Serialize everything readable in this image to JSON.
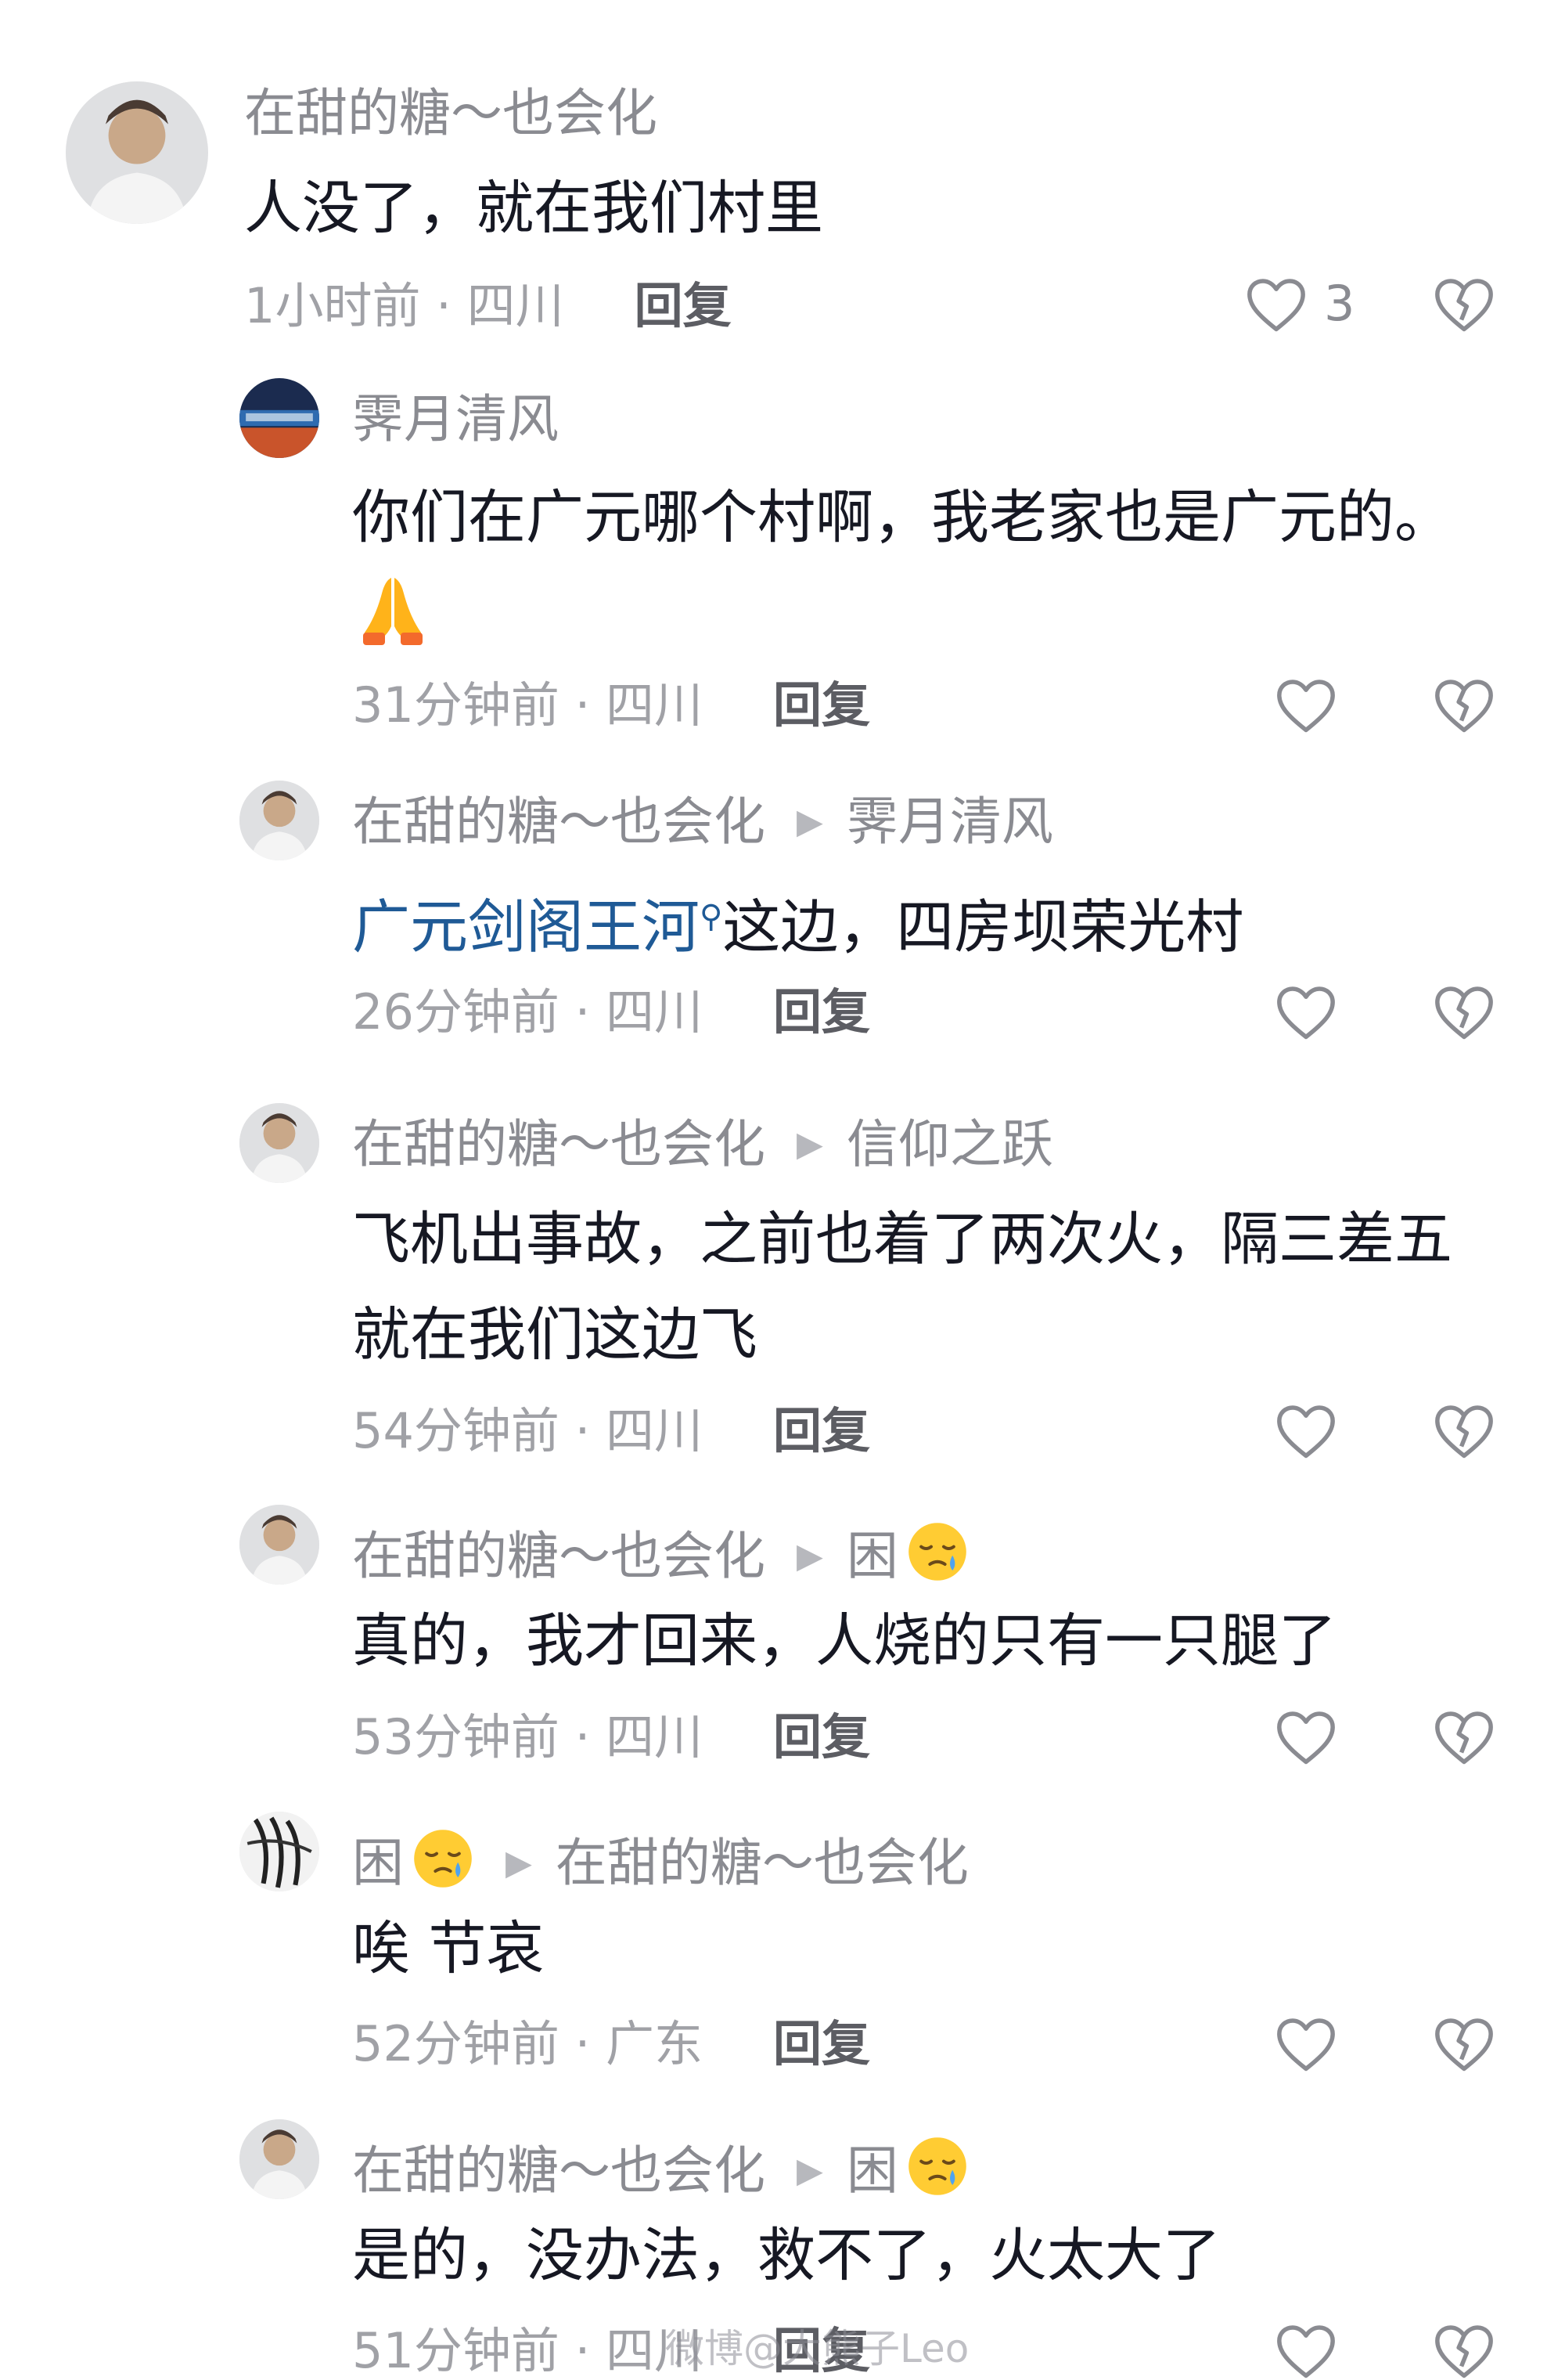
{
  "comments": [
    {
      "author": "在甜的糖～也会化",
      "reply_to": "",
      "text": "人没了，就在我们村里",
      "time_location": "1小时前 · 四川",
      "reply_label": "回复",
      "like_count": "3"
    },
    {
      "author": "霁月清风",
      "reply_to": "",
      "text": "你们在广元哪个村啊，我老家也是广元的。",
      "time_location": "31分钟前 · 四川",
      "reply_label": "回复",
      "like_count": ""
    },
    {
      "author": "在甜的糖～也会化",
      "reply_to": "霁月清风",
      "text_highlight": "广元剑阁王河",
      "text": "这边，四房坝荣光村",
      "time_location": "26分钟前 · 四川",
      "reply_label": "回复",
      "like_count": ""
    },
    {
      "author": "在甜的糖～也会化",
      "reply_to": "信仰之跃",
      "text_line1": "飞机出事故，之前也着了两次火，隔三差五",
      "text_line2": "就在我们这边飞",
      "time_location": "54分钟前 · 四川",
      "reply_label": "回复",
      "like_count": ""
    },
    {
      "author": "在甜的糖～也会化",
      "reply_to": "困",
      "text": "真的，我才回来，人烧的只有一只腿了",
      "time_location": "53分钟前 · 四川",
      "reply_label": "回复",
      "like_count": ""
    },
    {
      "author": "困",
      "reply_to": "在甜的糖～也会化",
      "text": "唉 节哀",
      "time_location": "52分钟前 · 广东",
      "reply_label": "回复",
      "like_count": ""
    },
    {
      "author": "在甜的糖～也会化",
      "reply_to": "困",
      "text": "是的，没办法，救不了，火太大了",
      "time_location": "51分钟前 · 四川",
      "reply_label": "回复",
      "like_count": ""
    }
  ],
  "watermark": "微博@大熊子Leo",
  "icons": {
    "like": "heart-outline-icon",
    "dislike": "broken-heart-icon",
    "reply_arrow": "play-triangle-icon",
    "emoji_pray": "folded-hands-emoji",
    "emoji_sleepy": "sleepy-face-emoji"
  },
  "colors": {
    "text": "#161823",
    "secondary": "#8a8b91",
    "link": "#1f5a96"
  }
}
